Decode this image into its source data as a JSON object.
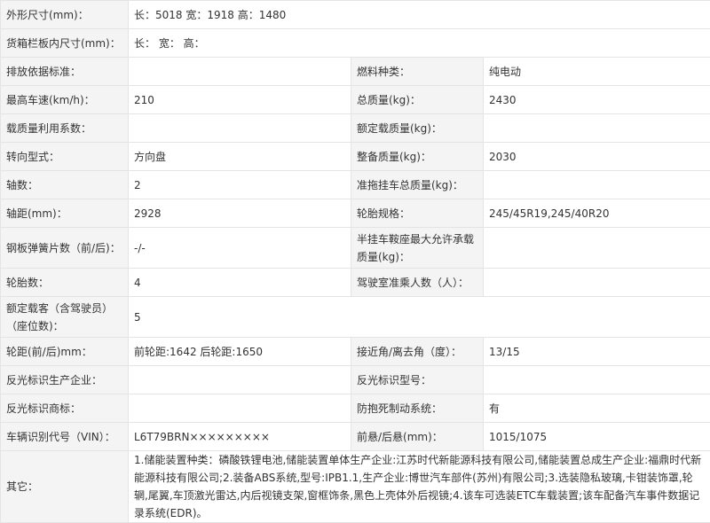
{
  "rows": [
    {
      "cells": [
        {
          "label": "外形尺寸(mm)：",
          "value": "长：5018 宽：1918 高：1480",
          "span": 3
        }
      ]
    },
    {
      "cells": [
        {
          "label": "货箱栏板内尺寸(mm)：",
          "value": "长： 宽： 高：",
          "span": 3
        }
      ]
    },
    {
      "cells": [
        {
          "label": "排放依据标准：",
          "value": ""
        },
        {
          "label": "燃料种类：",
          "value": "纯电动"
        }
      ]
    },
    {
      "cells": [
        {
          "label": "最高车速(km/h)：",
          "value": "210"
        },
        {
          "label": "总质量(kg)：",
          "value": "2430"
        }
      ]
    },
    {
      "cells": [
        {
          "label": "载质量利用系数：",
          "value": ""
        },
        {
          "label": "额定载质量(kg)：",
          "value": ""
        }
      ]
    },
    {
      "cells": [
        {
          "label": "转向型式：",
          "value": "方向盘"
        },
        {
          "label": "整备质量(kg)：",
          "value": "2030"
        }
      ]
    },
    {
      "cells": [
        {
          "label": "轴数：",
          "value": "2"
        },
        {
          "label": "准拖挂车总质量(kg)：",
          "value": ""
        }
      ]
    },
    {
      "cells": [
        {
          "label": "轴距(mm)：",
          "value": "2928"
        },
        {
          "label": "轮胎规格：",
          "value": "245/45R19,245/40R20"
        }
      ]
    },
    {
      "cells": [
        {
          "label": "钢板弹簧片数（前/后)：",
          "value": "-/-"
        },
        {
          "label": "半挂车鞍座最大允许承载质量(kg)：",
          "value": ""
        }
      ]
    },
    {
      "cells": [
        {
          "label": "轮胎数：",
          "value": "4"
        },
        {
          "label": "驾驶室准乘人数（人）：",
          "value": ""
        }
      ]
    },
    {
      "cells": [
        {
          "label": "额定载客（含驾驶员）（座位数)：",
          "value": "5",
          "span": 3
        }
      ]
    },
    {
      "cells": [
        {
          "label": "轮距(前/后)mm：",
          "value": "前轮距:1642 后轮距:1650"
        },
        {
          "label": "接近角/离去角（度）：",
          "value": "13/15"
        }
      ]
    },
    {
      "cells": [
        {
          "label": "反光标识生产企业：",
          "value": ""
        },
        {
          "label": "反光标识型号：",
          "value": ""
        }
      ]
    },
    {
      "cells": [
        {
          "label": "反光标识商标：",
          "value": ""
        },
        {
          "label": "防抱死制动系统：",
          "value": "有"
        }
      ]
    },
    {
      "cells": [
        {
          "label": "车辆识别代号（VIN）：",
          "value": "L6T79BRN×××××××××"
        },
        {
          "label": "前悬/后悬(mm)：",
          "value": "1015/1075"
        }
      ]
    },
    {
      "cells": [
        {
          "label": "其它：",
          "value": "1.储能装置种类：磷酸铁锂电池,储能装置单体生产企业:江苏时代新能源科技有限公司,储能装置总成生产企业:福鼎时代新能源科技有限公司;2.装备ABS系统,型号:IPB1.1,生产企业:博世汽车部件(苏州)有限公司;3.选装隐私玻璃,卡钳装饰罩,轮辋,尾翼,车顶激光雷达,内后视镜支架,窗框饰条,黑色上壳体外后视镜;4.该车可选装ETC车载装置;该车配备汽车事件数据记录系统(EDR)。",
          "span": 3
        }
      ]
    }
  ]
}
